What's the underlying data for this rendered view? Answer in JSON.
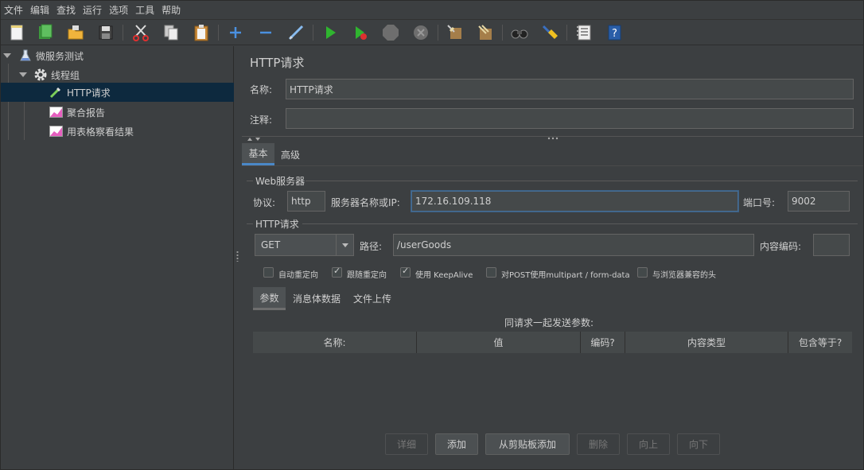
{
  "menu": [
    "文件",
    "编辑",
    "查找",
    "运行",
    "选项",
    "工具",
    "帮助"
  ],
  "toolbar_icons": [
    "new-icon",
    "templates-icon",
    "open-icon",
    "save-icon",
    "cut-icon",
    "copy-icon",
    "paste-icon",
    "expand-icon",
    "collapse-icon",
    "toggle-icon",
    "start-icon",
    "start-no-pause-icon",
    "stop-icon",
    "shutdown-icon",
    "clear-icon",
    "clear-all-icon",
    "search-icon",
    "reset-search-icon",
    "function-helper-icon",
    "help-icon"
  ],
  "tree": {
    "root": "微服务测试",
    "thread_group": "线程组",
    "http_request": "HTTP请求",
    "aggregate_report": "聚合报告",
    "table_results": "用表格察看结果"
  },
  "panel": {
    "title": "HTTP请求",
    "name_label": "名称:",
    "name_value": "HTTP请求",
    "comment_label": "注释:",
    "comment_value": "",
    "tabs": [
      "基本",
      "高级"
    ],
    "web_server_group": "Web服务器",
    "protocol_label": "协议:",
    "protocol_value": "http",
    "server_label": "服务器名称或IP:",
    "server_value": "172.16.109.118",
    "port_label": "端口号:",
    "port_value": "9002",
    "http_group": "HTTP请求",
    "method_value": "GET",
    "path_label": "路径:",
    "path_value": "/userGoods",
    "encoding_label": "内容编码:",
    "encoding_value": "",
    "checkboxes": [
      {
        "label": "自动重定向",
        "checked": false
      },
      {
        "label": "跟随重定向",
        "checked": true
      },
      {
        "label": "使用 KeepAlive",
        "checked": true
      },
      {
        "label": "对POST使用multipart / form-data",
        "checked": false
      },
      {
        "label": "与浏览器兼容的头",
        "checked": false
      }
    ],
    "subtabs": [
      "参数",
      "消息体数据",
      "文件上传"
    ],
    "params_caption": "同请求一起发送参数:",
    "columns": [
      "名称:",
      "值",
      "编码?",
      "内容类型",
      "包含等于?"
    ],
    "buttons": {
      "detail": "详细",
      "add": "添加",
      "add_clipboard": "从剪贴板添加",
      "delete": "删除",
      "up": "向上",
      "down": "向下"
    }
  },
  "colors": {
    "background": "#3c3f41",
    "selection": "#0d293e",
    "accent": "#4a88c7"
  }
}
